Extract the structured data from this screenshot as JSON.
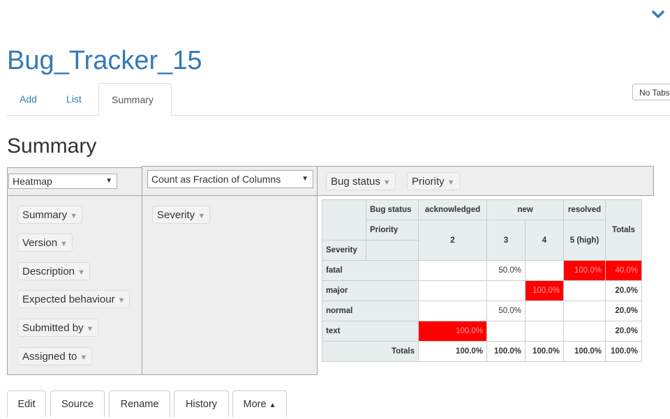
{
  "app": {
    "title": "Bug_Tracker_15"
  },
  "tabs": [
    "Add",
    "List",
    "Summary"
  ],
  "no_tabs_label": "No Tabs",
  "section_title": "Summary",
  "renderer": {
    "selected": "Heatmap"
  },
  "aggregator": {
    "selected": "Count as Fraction of Columns"
  },
  "col_fields": [
    "Bug status",
    "Priority"
  ],
  "row_fields": [
    "Severity"
  ],
  "unused_fields": [
    "Summary",
    "Version",
    "Description",
    "Expected behaviour",
    "Submitted by",
    "Assigned to"
  ],
  "table": {
    "col_attr_labels": [
      "Bug status",
      "Priority"
    ],
    "row_attr_label": "Severity",
    "status_groups": [
      "acknowledged",
      "new",
      "resolved"
    ],
    "priorities": [
      "2",
      "3",
      "4",
      "5 (high)"
    ],
    "totals_label": "Totals",
    "rows": [
      {
        "label": "fatal",
        "cells": [
          "",
          "50.0%",
          "",
          "100.0%"
        ],
        "total": "40.0%"
      },
      {
        "label": "major",
        "cells": [
          "",
          "",
          "100.0%",
          ""
        ],
        "total": "20.0%"
      },
      {
        "label": "normal",
        "cells": [
          "",
          "50.0%",
          "",
          ""
        ],
        "total": "20.0%"
      },
      {
        "label": "text",
        "cells": [
          "100.0%",
          "",
          "",
          ""
        ],
        "total": "20.0%"
      }
    ],
    "col_totals": [
      "100.0%",
      "100.0%",
      "100.0%",
      "100.0%"
    ],
    "grand_total": "100.0%",
    "heat_color": "#ff0000"
  },
  "actions": [
    "Edit",
    "Source",
    "Rename",
    "History",
    "More"
  ]
}
